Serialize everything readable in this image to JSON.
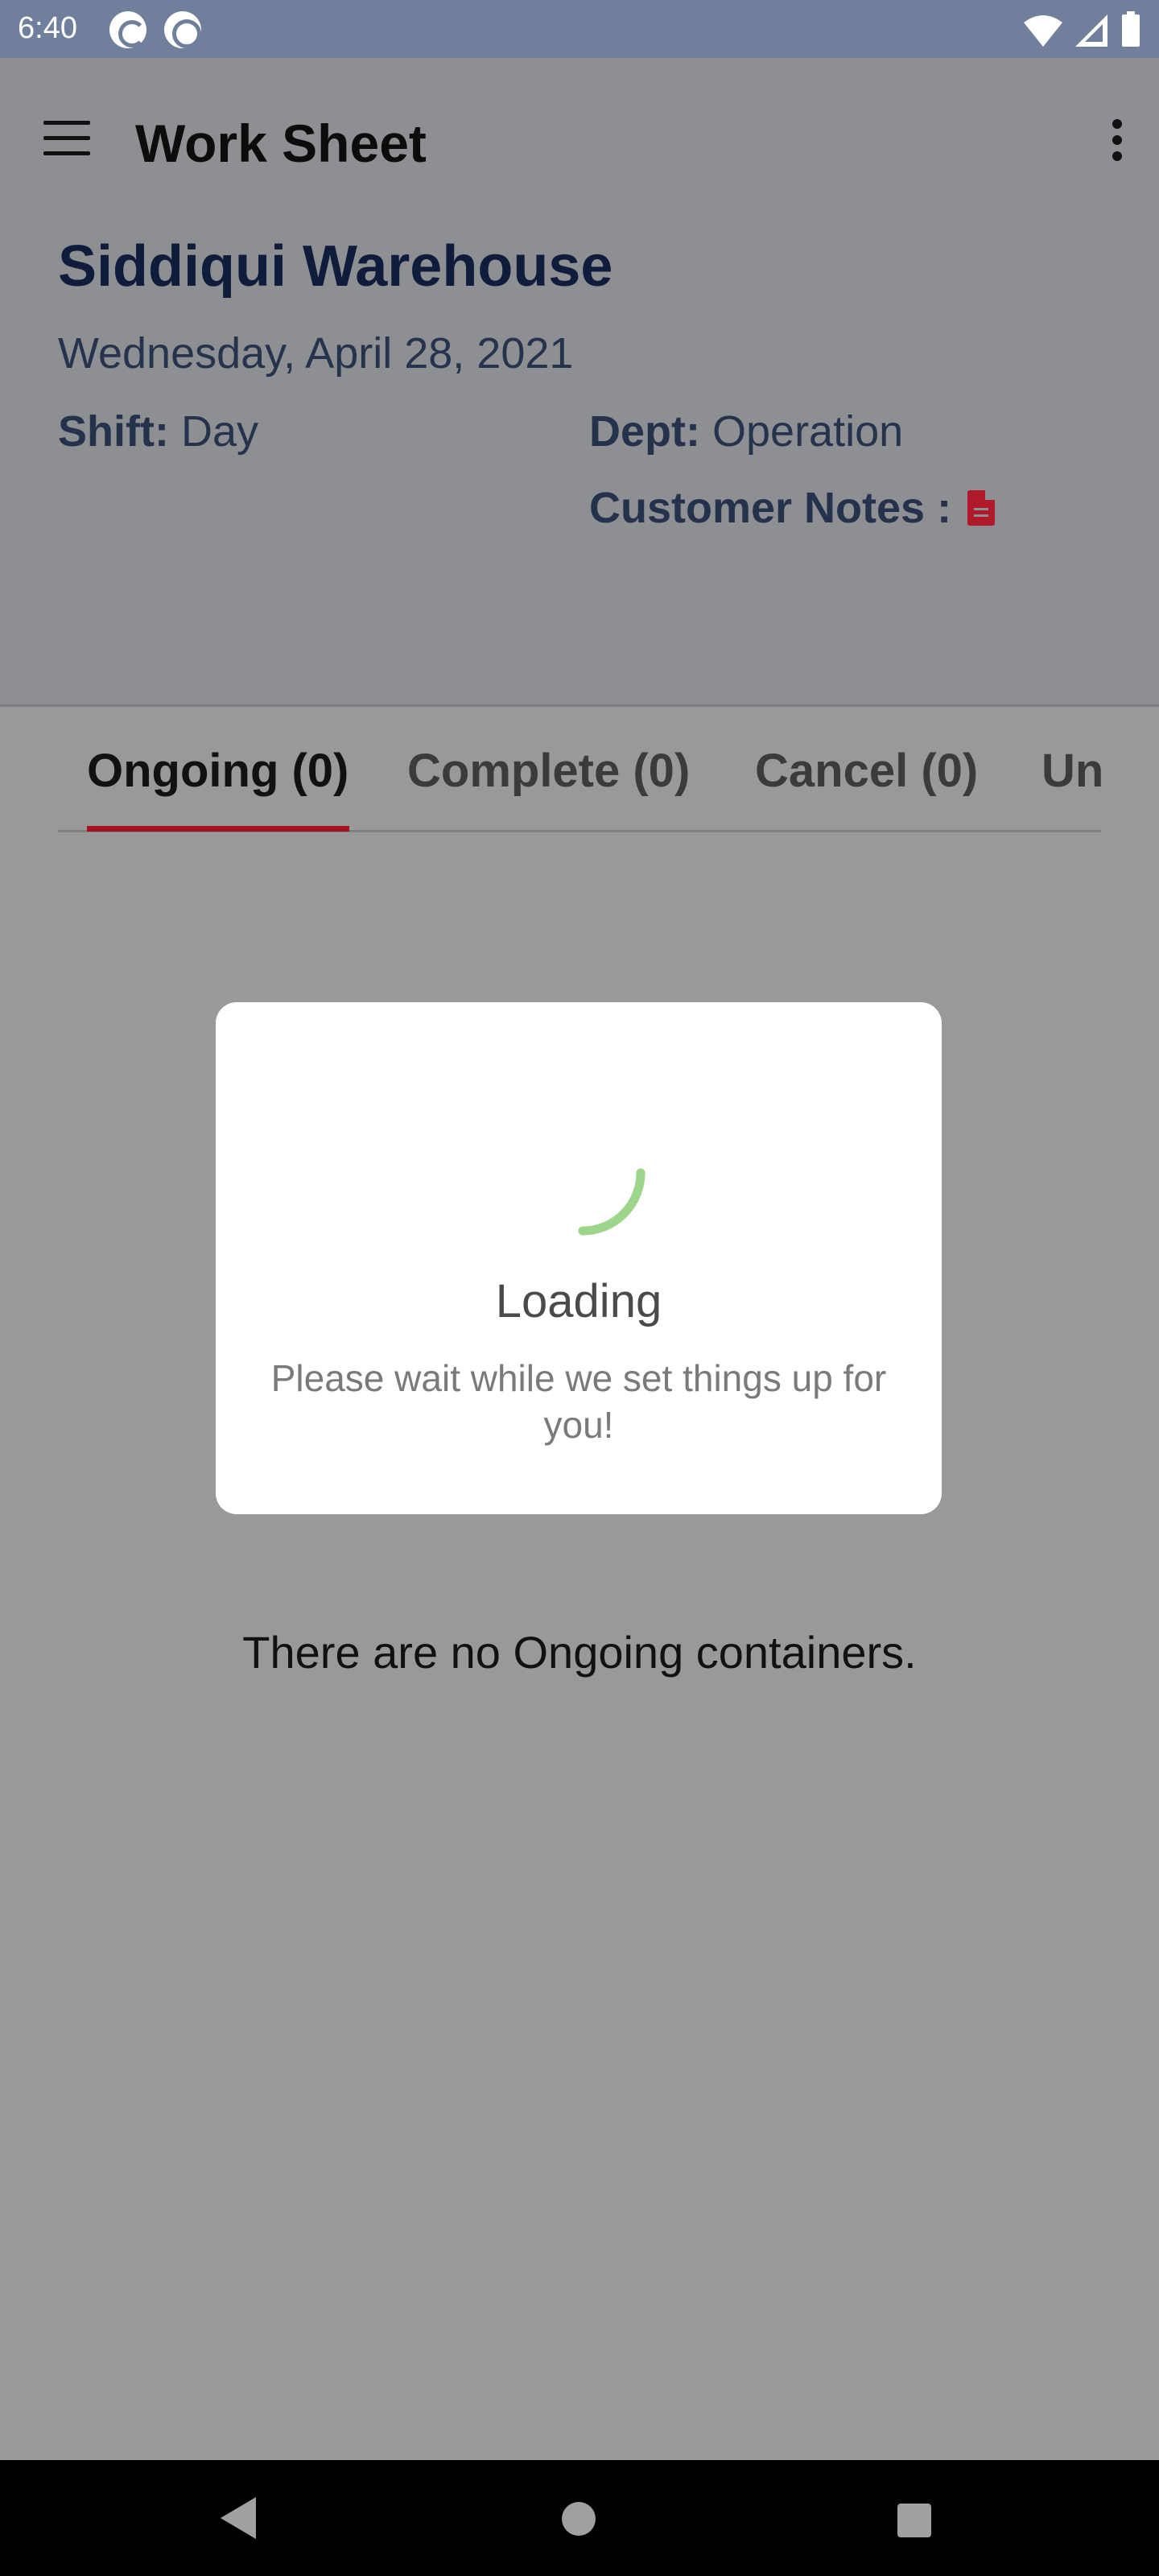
{
  "status_bar": {
    "time": "6:40",
    "left_icons": [
      "sync-icon",
      "do-not-disturb-icon"
    ],
    "right_icons": [
      "wifi-icon",
      "signal-icon",
      "battery-icon"
    ]
  },
  "app_bar": {
    "title": "Work Sheet",
    "menu_icon": "hamburger-menu-icon",
    "more_icon": "more-vertical-icon"
  },
  "header": {
    "warehouse": "Siddiqui Warehouse",
    "date": "Wednesday, April 28, 2021",
    "shift_label": "Shift:",
    "shift_value": "Day",
    "dept_label": "Dept:",
    "dept_value": "Operation",
    "notes_label": "Customer Notes :",
    "notes_icon": "document-icon",
    "notes_icon_color": "#b0192a"
  },
  "tabs": [
    {
      "label": "Ongoing (0)",
      "active": true
    },
    {
      "label": "Complete (0)",
      "active": false
    },
    {
      "label": "Cancel (0)",
      "active": false
    },
    {
      "label": "Un",
      "active": false
    }
  ],
  "tab_accent_color": "#a3121f",
  "empty_message": "There are no Ongoing containers.",
  "loading_dialog": {
    "title": "Loading",
    "message": "Please wait while we set things up for you!",
    "spinner_color": "#9dd68a"
  },
  "nav_bar": {
    "buttons": [
      "back-icon",
      "home-icon",
      "recents-icon"
    ]
  }
}
